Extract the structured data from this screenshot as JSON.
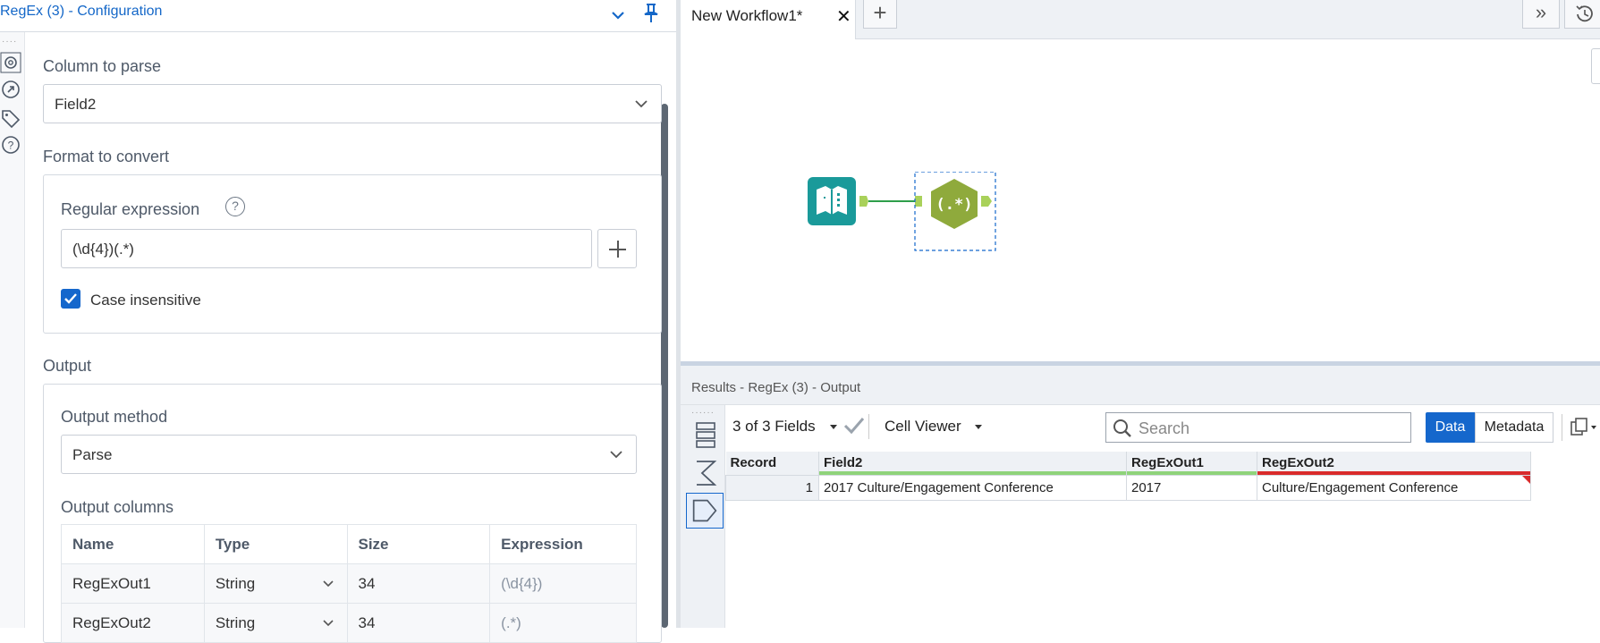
{
  "config": {
    "title": "RegEx (3) - Configuration",
    "column_to_parse_label": "Column to parse",
    "column_to_parse_value": "Field2",
    "format_label": "Format to convert",
    "regex_label": "Regular expression",
    "regex_help": "?",
    "regex_value": "(\\d{4})(.*)",
    "case_insensitive_label": "Case insensitive",
    "case_insensitive_checked": true,
    "output_label": "Output",
    "output_method_label": "Output method",
    "output_method_value": "Parse",
    "output_columns_label": "Output columns",
    "columns_headers": [
      "Name",
      "Type",
      "Size",
      "Expression"
    ],
    "columns_rows": [
      {
        "name": "RegExOut1",
        "type": "String",
        "size": "34",
        "expression": "(\\d{4})"
      },
      {
        "name": "RegExOut2",
        "type": "String",
        "size": "34",
        "expression": "(.*)"
      }
    ]
  },
  "canvas": {
    "tab_title": "New Workflow1*",
    "tab_close": "✕",
    "tab_add": "+",
    "tab_more": "»",
    "regex_tool_label": "(.*)"
  },
  "results": {
    "title": "Results - RegEx (3) - Output",
    "fields_selector": "3 of 3 Fields",
    "cell_viewer": "Cell Viewer",
    "search_placeholder": "Search",
    "data_button": "Data",
    "metadata_button": "Metadata",
    "headers": [
      "Record",
      "Field2",
      "RegExOut1",
      "RegExOut2"
    ],
    "rows": [
      {
        "record": "1",
        "field2": "2017 Culture/Engagement Conference",
        "out1": "2017",
        "out2": "Culture/Engagement Conference"
      }
    ]
  },
  "colors": {
    "accent": "#1567cc",
    "tool_teal": "#1a9a9a",
    "tool_regex": "#8faa3c",
    "bar_green": "#8fd37a",
    "bar_red": "#d92b2b"
  }
}
